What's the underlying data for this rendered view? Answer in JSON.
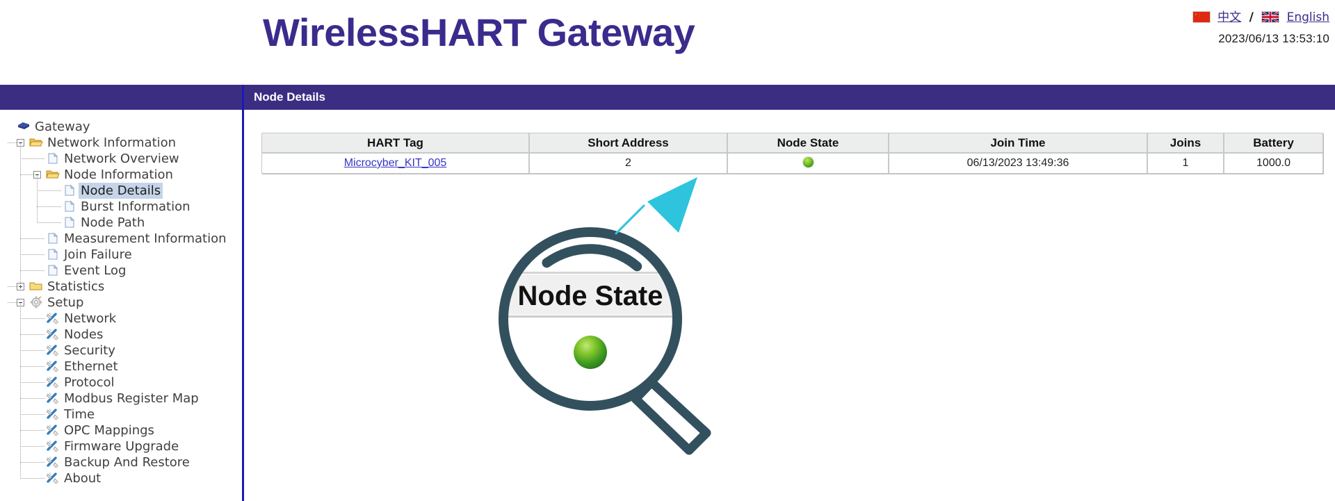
{
  "header": {
    "app_title": "WirelessHART Gateway",
    "lang": {
      "chinese_label": "中文",
      "separator": "/",
      "english_label": "English",
      "chinese_flag_icon": "china-flag-icon",
      "english_flag_icon": "uk-flag-icon"
    },
    "timestamp": "2023/06/13 13:53:10"
  },
  "banner": {
    "title": "Node Details"
  },
  "sidebar": {
    "items": [
      {
        "label": "Gateway",
        "icon": "gateway-icon",
        "depth": 0,
        "expander": "none",
        "selected": false
      },
      {
        "label": "Network Information",
        "icon": "folder-open-icon",
        "depth": 1,
        "expander": "minus",
        "selected": false
      },
      {
        "label": "Network Overview",
        "icon": "page-icon",
        "depth": 2,
        "expander": "none",
        "selected": false
      },
      {
        "label": "Node Information",
        "icon": "folder-open-icon",
        "depth": 2,
        "expander": "minus",
        "selected": false
      },
      {
        "label": "Node Details",
        "icon": "page-icon",
        "depth": 3,
        "expander": "none",
        "selected": true
      },
      {
        "label": "Burst Information",
        "icon": "page-icon",
        "depth": 3,
        "expander": "none",
        "selected": false
      },
      {
        "label": "Node Path",
        "icon": "page-icon",
        "depth": 3,
        "expander": "none",
        "selected": false
      },
      {
        "label": "Measurement Information",
        "icon": "page-icon",
        "depth": 2,
        "expander": "none",
        "selected": false
      },
      {
        "label": "Join Failure",
        "icon": "page-icon",
        "depth": 2,
        "expander": "none",
        "selected": false
      },
      {
        "label": "Event Log",
        "icon": "page-icon",
        "depth": 2,
        "expander": "none",
        "selected": false
      },
      {
        "label": "Statistics",
        "icon": "folder-closed-icon",
        "depth": 1,
        "expander": "plus",
        "selected": false
      },
      {
        "label": "Setup",
        "icon": "gear-icon",
        "depth": 1,
        "expander": "minus",
        "selected": false
      },
      {
        "label": "Network",
        "icon": "wrench-icon",
        "depth": 2,
        "expander": "none",
        "selected": false
      },
      {
        "label": "Nodes",
        "icon": "wrench-icon",
        "depth": 2,
        "expander": "none",
        "selected": false
      },
      {
        "label": "Security",
        "icon": "wrench-icon",
        "depth": 2,
        "expander": "none",
        "selected": false
      },
      {
        "label": "Ethernet",
        "icon": "wrench-icon",
        "depth": 2,
        "expander": "none",
        "selected": false
      },
      {
        "label": "Protocol",
        "icon": "wrench-icon",
        "depth": 2,
        "expander": "none",
        "selected": false
      },
      {
        "label": "Modbus Register Map",
        "icon": "wrench-icon",
        "depth": 2,
        "expander": "none",
        "selected": false
      },
      {
        "label": "Time",
        "icon": "wrench-icon",
        "depth": 2,
        "expander": "none",
        "selected": false
      },
      {
        "label": "OPC Mappings",
        "icon": "wrench-icon",
        "depth": 2,
        "expander": "none",
        "selected": false
      },
      {
        "label": "Firmware Upgrade",
        "icon": "wrench-icon",
        "depth": 2,
        "expander": "none",
        "selected": false
      },
      {
        "label": "Backup And Restore",
        "icon": "wrench-icon",
        "depth": 2,
        "expander": "none",
        "selected": false
      },
      {
        "label": "About",
        "icon": "wrench-icon",
        "depth": 2,
        "expander": "none",
        "selected": false
      }
    ]
  },
  "table": {
    "columns": [
      "HART Tag",
      "Short Address",
      "Node State",
      "Join Time",
      "Joins",
      "Battery"
    ],
    "rows": [
      {
        "hart_tag": "Microcyber_KIT_005",
        "short_address": "2",
        "node_state": "online",
        "node_state_color": "#7fc428",
        "join_time": "06/13/2023 13:49:36",
        "joins": "1",
        "battery": "1000.0"
      }
    ]
  },
  "annotation": {
    "magnifier_label": "Node State",
    "magnifier_color": "#33505e",
    "arrow_color": "#2ec4de",
    "led_color": "#7fc428"
  },
  "colors": {
    "banner_purple": "#3b2e82",
    "title_purple": "#3b2b8c",
    "divider_blue": "#1a1ab8",
    "link_blue": "#3535c8",
    "selection_blue": "#c5d4e8"
  }
}
